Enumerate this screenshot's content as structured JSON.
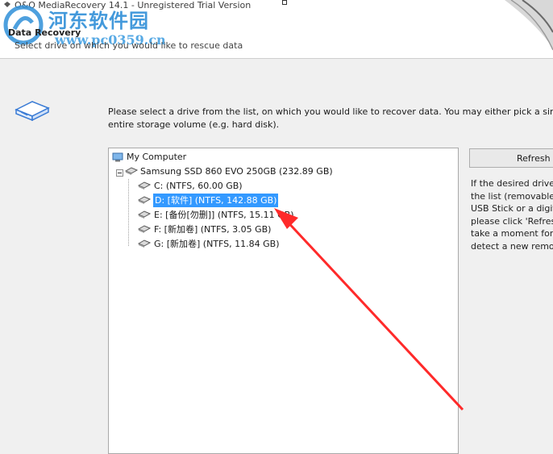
{
  "window": {
    "title": "O&O MediaRecovery 14.1 - Unregistered Trial Version"
  },
  "watermark": {
    "name": "河东软件园",
    "url": "www.pc0359.cn"
  },
  "header": {
    "title": "Data Recovery",
    "subtitle": "Select drive on which you would like to rescue data"
  },
  "instructions": {
    "line1": "Please select a drive from the list, on which you would like to recover data. You may either pick a single p",
    "line2": "entire storage volume (e.g. hard disk)."
  },
  "tree": {
    "root": "My Computer",
    "disk": "Samsung SSD 860 EVO 250GB (232.89 GB)",
    "partitions": [
      {
        "label": "C: (NTFS, 60.00 GB)",
        "selected": false
      },
      {
        "label": "D: [软件] (NTFS, 142.88 GB)",
        "selected": true
      },
      {
        "label": "E: [备份[勿删]] (NTFS, 15.11 GB)",
        "selected": false
      },
      {
        "label": "F: [新加卷] (NTFS, 3.05 GB)",
        "selected": false
      },
      {
        "label": "G: [新加卷] (NTFS, 11.84 GB)",
        "selected": false
      }
    ]
  },
  "refresh_button": {
    "label": "Refresh l"
  },
  "side_note": {
    "lines": [
      "If the desired drive",
      "the list (removable",
      "USB Stick or a digit",
      "please click 'Refresh",
      "take a moment for",
      "detect a new remov"
    ]
  },
  "colors": {
    "selection": "#3399ff",
    "arrow": "#ff2a2a",
    "watermark": "#2f8fd8"
  }
}
